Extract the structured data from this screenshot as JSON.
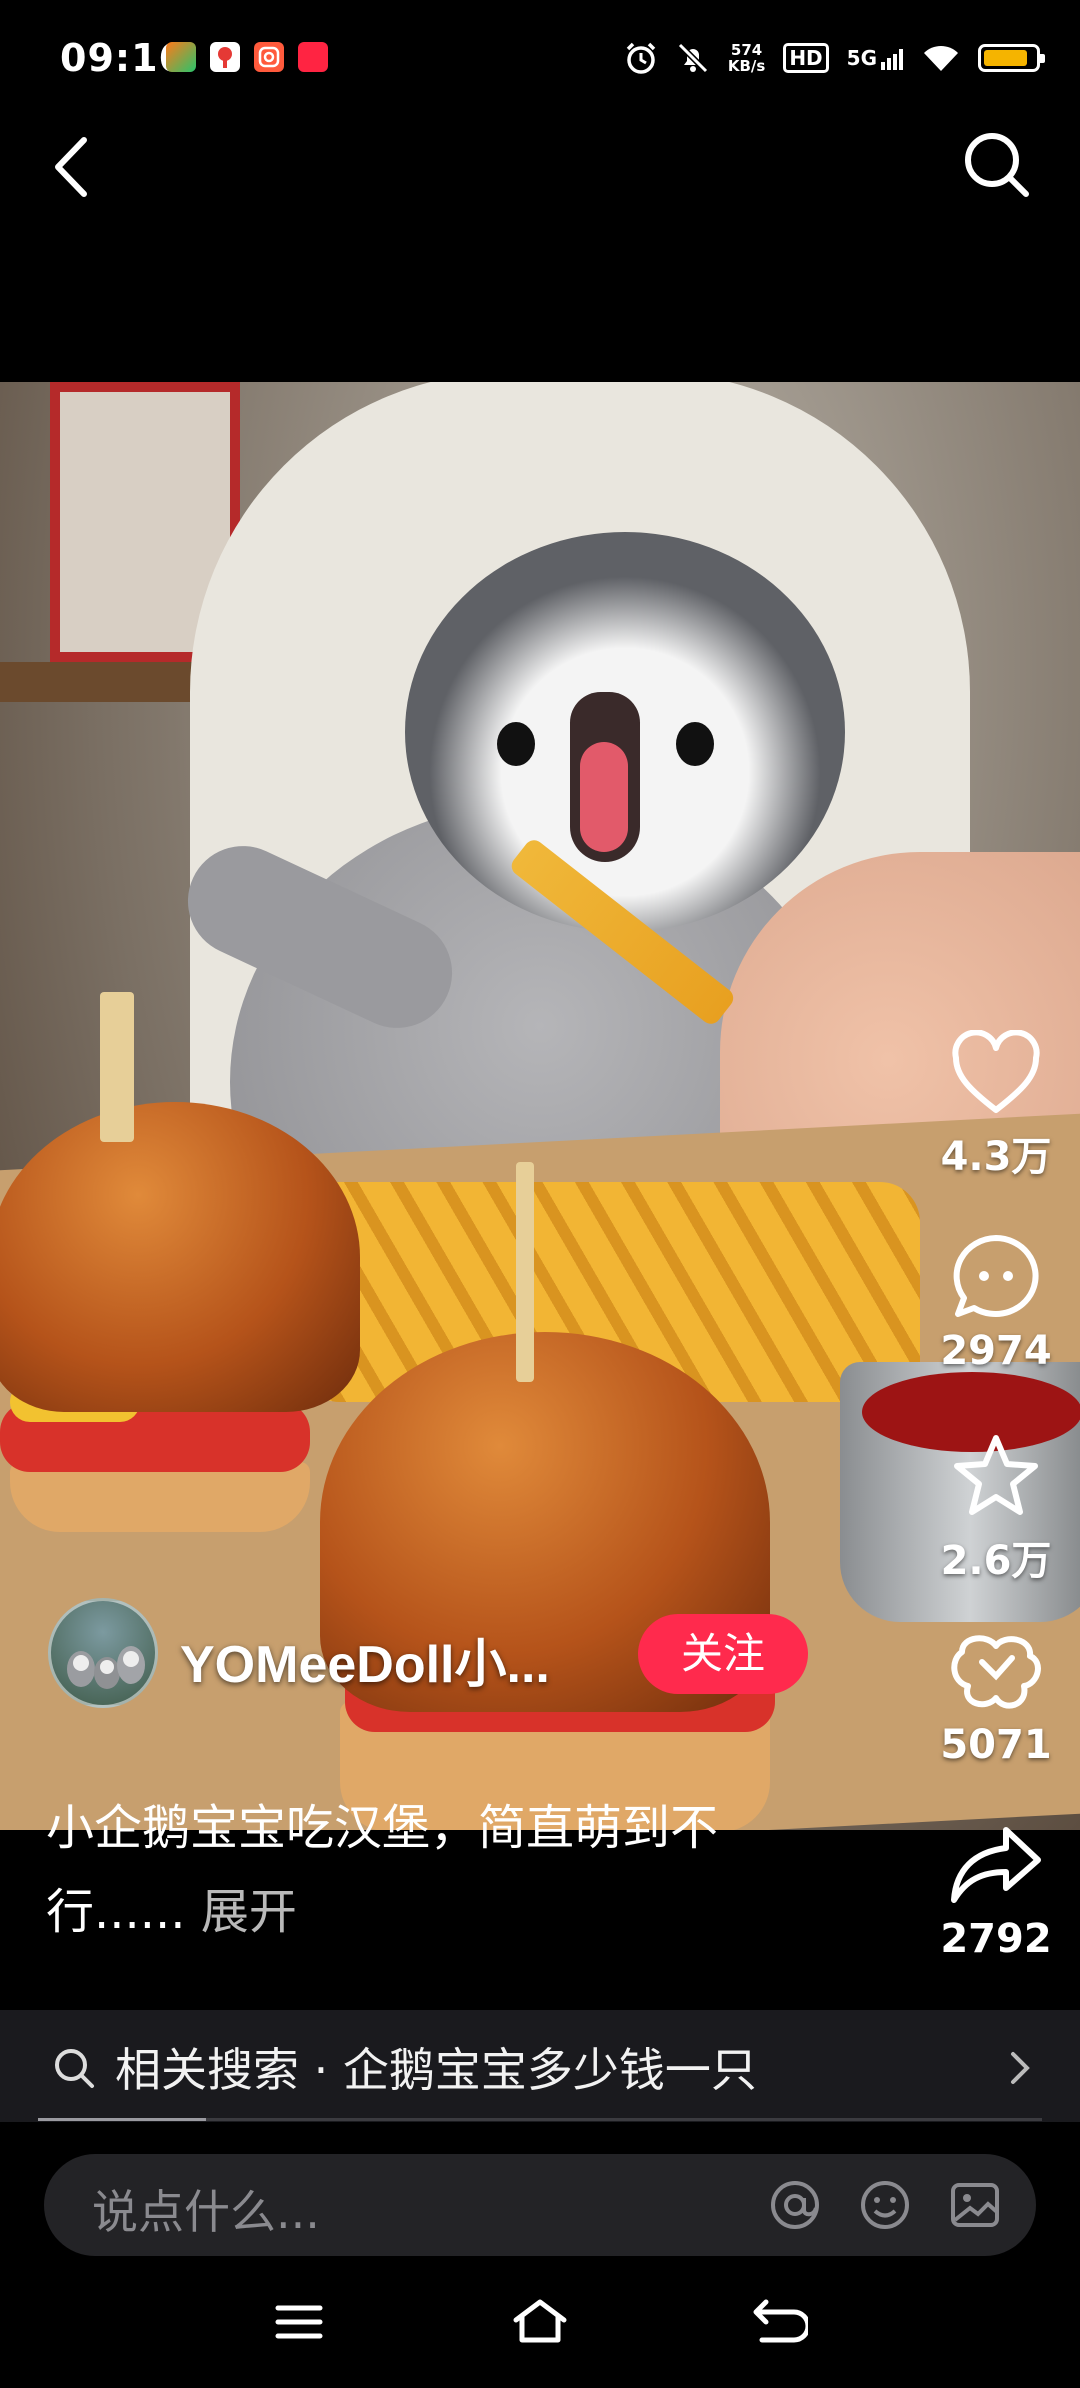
{
  "status_bar": {
    "time": "09:16",
    "net_speed_value": "574",
    "net_speed_unit": "KB/s",
    "hd": "HD",
    "network": "5G",
    "battery_level": 0.85,
    "battery_color": "#f5b400",
    "icons": [
      "app-notify-icon",
      "map-app-icon",
      "camera-app-icon",
      "shop-app-icon",
      "alarm-icon",
      "mute-icon",
      "wifi-icon",
      "battery-icon"
    ]
  },
  "author": {
    "name": "YOMeeDoll小...",
    "follow_label": "关注"
  },
  "actions": {
    "likes": "4.3万",
    "comments": "2974",
    "favorites": "2.6万",
    "shares_wechat": "5071",
    "forwards": "2792"
  },
  "caption": {
    "line1": "小企鹅宝宝吃汉堡，简直萌到不",
    "line2": "行......",
    "more": " 展开"
  },
  "related": {
    "text": "相关搜索 · 企鹅宝宝多少钱一只"
  },
  "comment": {
    "placeholder": "说点什么..."
  },
  "colors": {
    "follow": "#ff2a4d",
    "background": "#000000"
  }
}
